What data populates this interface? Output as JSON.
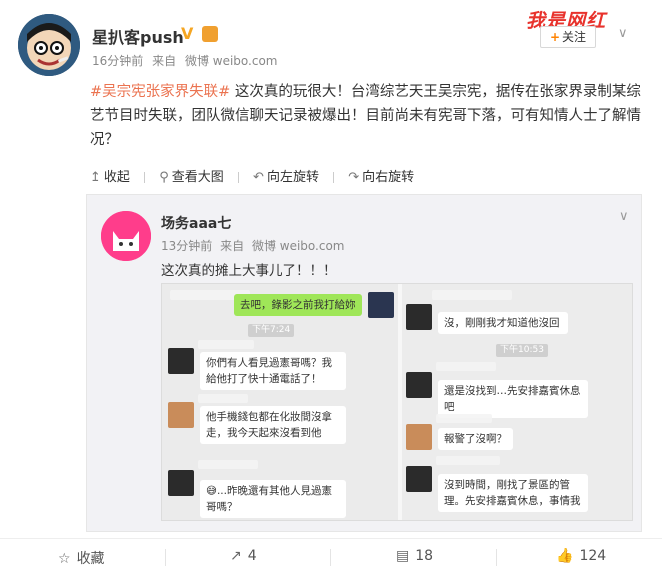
{
  "header": {
    "author": "星扒客push",
    "verified_mark": "V",
    "time": "16分钟前",
    "source_prefix": "来自",
    "source": "微博 weibo.com",
    "brand": "我是网红",
    "follow_label": "关注",
    "follow_plus": "+"
  },
  "post": {
    "hashtag": "#吴宗宪张家界失联#",
    "text": " 这次真的玩很大！台湾综艺天王吴宗宪，据传在张家界录制某综艺节目时失联，团队微信聊天记录被爆出！目前尚未有宪哥下落，可有知情人士了解情况？"
  },
  "toolbar": {
    "collapse": "收起",
    "view_large": "查看大图",
    "rotate_left": "向左旋转",
    "rotate_right": "向右旋转",
    "icons": [
      "collapse-arrow-icon",
      "magnifier-icon",
      "rotate-left-icon",
      "rotate-right-icon"
    ]
  },
  "quote": {
    "author": "场务aaa七",
    "time": "13分钟前",
    "source_prefix": "来自",
    "source": "微博 weibo.com",
    "text": "这次真的摊上大事儿了！！！"
  },
  "chat_left": {
    "outgoing": "去吧，錄影之前我打給妳",
    "time": "下午7:24",
    "msg1": "你們有人看見過憲哥嗎？我給他打了快十通電話了！",
    "msg2": "他手機錢包都在化妝間沒拿走，我今天起來沒看到他",
    "msg3": "😅...昨晚還有其他人見過憲哥嗎？"
  },
  "chat_right": {
    "msg1": "沒，剛剛我才知道他沒回",
    "time": "下午10:53",
    "msg2": "還是沒找到…先安排嘉賓休息吧",
    "msg3": "報警了沒啊？",
    "msg4": "沒到時間，剛找了景區的管理。先安排嘉賓休息，事情我"
  },
  "actions": {
    "favorite": "收藏",
    "repost": "4",
    "comment": "18",
    "like": "124"
  },
  "colors": {
    "hashtag": "#eb7350",
    "accent_orange": "#ff8200",
    "brand_red": "#e8322c",
    "wechat_green": "#9fe658"
  }
}
